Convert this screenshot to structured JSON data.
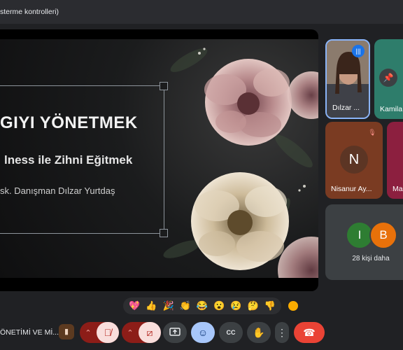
{
  "topbar": {
    "text": "sterme kontrolleri)"
  },
  "slide": {
    "title": "GIYI YÖNETMEK",
    "subtitle": "lness ile Zihni Eğitmek",
    "author": "sk. Danışman Dılzar Yurtdaş"
  },
  "participants": [
    {
      "name": "Dılzar ...",
      "speaking": true
    },
    {
      "name": "Kamila",
      "pinned_icon": "pin-icon"
    },
    {
      "name": "Nisanur Ay...",
      "initial": "N",
      "muted": true
    },
    {
      "name": "Ma"
    }
  ],
  "others": {
    "avatars": [
      "I",
      "B"
    ],
    "label": "28 kişi daha"
  },
  "reactions": [
    "💖",
    "👍",
    "🎉",
    "👏",
    "😂",
    "😮",
    "😢",
    "🤔",
    "👎"
  ],
  "meeting_title": "ÖNETİMİ VE Mİ...",
  "controls": {
    "mic": "mic-off",
    "camera": "camera-off",
    "present": "present-screen",
    "emoji": "emoji",
    "captions": "CC",
    "raise_hand": "hand",
    "more": "more-options",
    "leave": "end-call"
  },
  "colors": {
    "accent": "#8ab4f8",
    "end_call": "#ea4335",
    "off_button": "#8c1d18"
  }
}
